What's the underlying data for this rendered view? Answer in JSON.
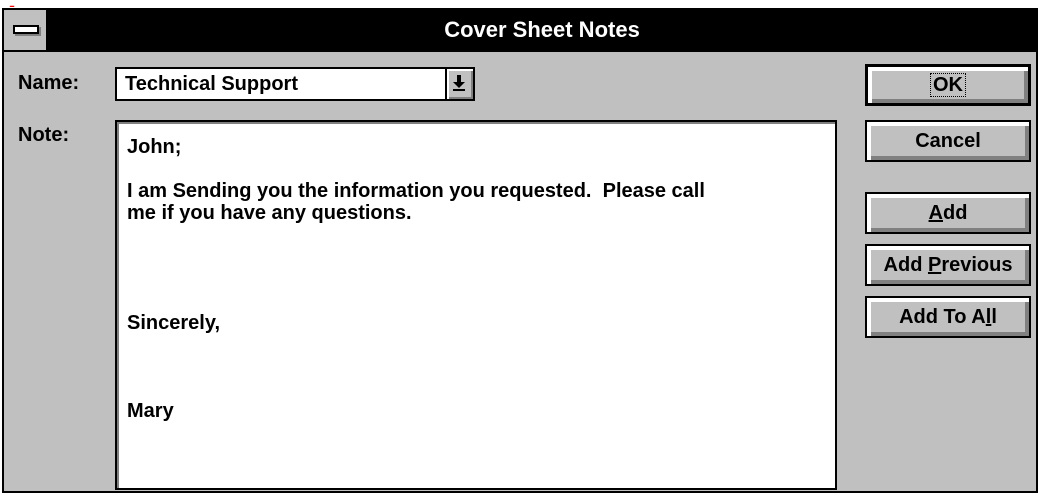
{
  "window": {
    "title": "Cover Sheet Notes"
  },
  "form": {
    "name_label": "Name:",
    "name_value": "Technical Support",
    "note_label": "Note:",
    "note_lines": [
      "John;",
      "",
      "I am Sending you the information you requested.  Please call",
      "me if you have any questions.",
      "",
      "",
      "",
      "",
      "Sincerely,",
      "",
      "",
      "",
      "Mary"
    ]
  },
  "buttons": {
    "ok": "OK",
    "cancel": "Cancel",
    "add_pre": "",
    "add_mn": "A",
    "add_post": "dd",
    "add_previous_pre": "Add ",
    "add_previous_mn": "P",
    "add_previous_post": "revious",
    "add_to_all_pre": "Add To A",
    "add_to_all_mn": "l",
    "add_to_all_post": "l"
  },
  "icons": {
    "system_menu": "system-menu-icon",
    "dropdown": "dropdown-arrow-icon"
  },
  "colors": {
    "titlebar": "#000000",
    "face": "#c0c0c0",
    "field": "#ffffff"
  }
}
